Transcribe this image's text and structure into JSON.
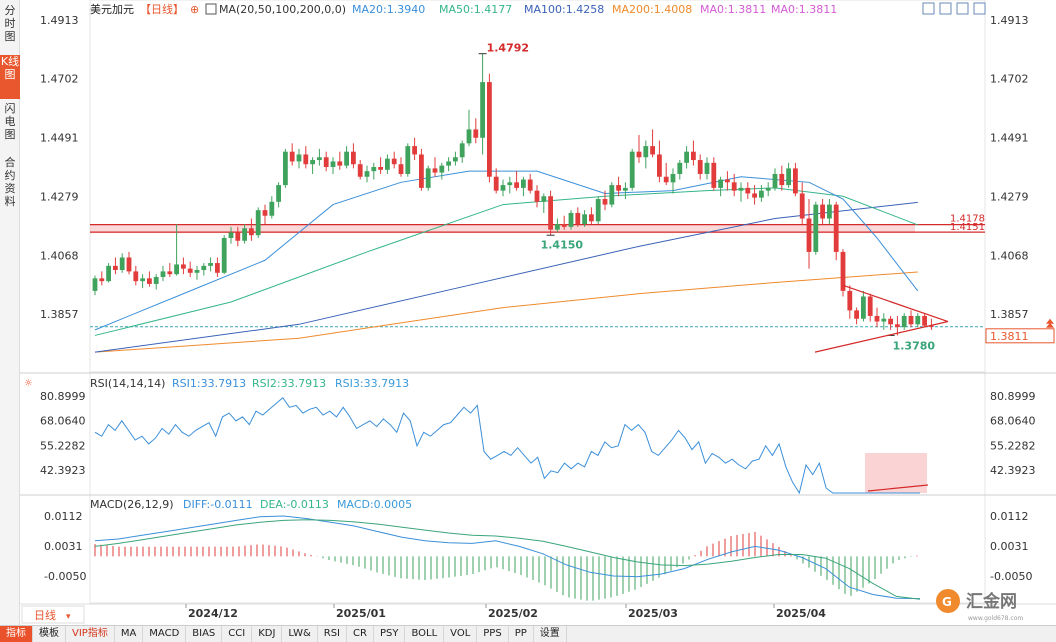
{
  "tabs": [
    "分时图",
    "K线图",
    "闪电图",
    "合约资料"
  ],
  "active_tab": 1,
  "header": {
    "symbol": "美元加元",
    "period": "【日线】",
    "ma_label": "MA(20,50,100,200,0,0)",
    "ma20": "MA20:1.3940",
    "ma50": "MA50:1.4177",
    "ma100": "MA100:1.4258",
    "ma200": "MA200:1.4008",
    "ma0a": "MA0:1.3811",
    "ma0b": "MA0:1.3811"
  },
  "rsi_header": {
    "label": "RSI(14,14,14)",
    "rsi1": "RSI1:33.7913",
    "rsi2": "RSI2:33.7913",
    "rsi3": "RSI3:33.7913"
  },
  "macd_header": {
    "label": "MACD(26,12,9)",
    "diff": "DIFF:-0.0111",
    "dea": "DEA:-0.0113",
    "macd": "MACD:0.0005"
  },
  "price_ticks": [
    "1.4913",
    "1.4702",
    "1.4491",
    "1.4279",
    "1.4068",
    "1.3857"
  ],
  "rsi_ticks": [
    "80.8999",
    "68.0640",
    "55.2282",
    "42.3923"
  ],
  "macd_ticks": [
    "0.0112",
    "0.0031",
    "-0.0050"
  ],
  "date_labels": [
    "2024/12",
    "2025/01",
    "2025/02",
    "2025/03",
    "2025/04"
  ],
  "current_price": "1.3811",
  "annotations": {
    "high": "1.4792",
    "mid_low": "1.4150",
    "low": "1.3780",
    "res1": "1.4178",
    "res2": "1.4151"
  },
  "period_tab": "日线",
  "toolbar": [
    "指标",
    "模板",
    "VIP指标",
    "MA",
    "MACD",
    "BIAS",
    "CCI",
    "KDJ",
    "LW&",
    "RSI",
    "CR",
    "PSY",
    "BOLL",
    "VOL",
    "PPS",
    "PP",
    "设置"
  ],
  "watermark": "汇金网",
  "watermark_url": "www.gold678.com",
  "colors": {
    "up": "#3fa35e",
    "down": "#e23b3b",
    "ma20": "#3b8fd9",
    "ma50": "#35b58a",
    "ma100": "#3a62b8",
    "ma200": "#f08a2c",
    "rsi": "#3b8fd9",
    "dea": "#3aa57a",
    "diff": "#3b8fd9"
  },
  "chart_data": {
    "type": "candlestick",
    "ylim": [
      1.378,
      1.4913
    ],
    "candles": [
      [
        1.394,
        1.3995,
        1.3925,
        1.3985
      ],
      [
        1.3985,
        1.401,
        1.396,
        1.3975
      ],
      [
        1.3975,
        1.404,
        1.397,
        1.403
      ],
      [
        1.403,
        1.406,
        1.4,
        1.4015
      ],
      [
        1.4015,
        1.4075,
        1.4005,
        1.406
      ],
      [
        1.406,
        1.408,
        1.4,
        1.401
      ],
      [
        1.401,
        1.403,
        1.396,
        1.3975
      ],
      [
        1.3975,
        1.4,
        1.395,
        1.3985
      ],
      [
        1.3985,
        1.401,
        1.3955,
        1.3965
      ],
      [
        1.3965,
        1.4,
        1.3945,
        1.399
      ],
      [
        1.399,
        1.403,
        1.3975,
        1.401
      ],
      [
        1.401,
        1.404,
        1.399,
        1.4
      ],
      [
        1.4,
        1.418,
        1.3995,
        1.4035
      ],
      [
        1.4035,
        1.406,
        1.4,
        1.402
      ],
      [
        1.402,
        1.4045,
        1.399,
        1.4005
      ],
      [
        1.4005,
        1.403,
        1.398,
        1.4015
      ],
      [
        1.4015,
        1.404,
        1.3995,
        1.403
      ],
      [
        1.403,
        1.406,
        1.401,
        1.404
      ],
      [
        1.404,
        1.406,
        1.399,
        1.4005
      ],
      [
        1.4005,
        1.414,
        1.4,
        1.413
      ],
      [
        1.413,
        1.417,
        1.411,
        1.415
      ],
      [
        1.415,
        1.417,
        1.41,
        1.412
      ],
      [
        1.412,
        1.418,
        1.411,
        1.4165
      ],
      [
        1.4165,
        1.42,
        1.412,
        1.414
      ],
      [
        1.414,
        1.424,
        1.413,
        1.423
      ],
      [
        1.423,
        1.425,
        1.418,
        1.421
      ],
      [
        1.421,
        1.428,
        1.42,
        1.426
      ],
      [
        1.426,
        1.433,
        1.424,
        1.432
      ],
      [
        1.432,
        1.445,
        1.431,
        1.444
      ],
      [
        1.444,
        1.447,
        1.439,
        1.4405
      ],
      [
        1.4405,
        1.445,
        1.438,
        1.443
      ],
      [
        1.443,
        1.446,
        1.438,
        1.4395
      ],
      [
        1.4395,
        1.442,
        1.436,
        1.441
      ],
      [
        1.441,
        1.445,
        1.439,
        1.442
      ],
      [
        1.442,
        1.444,
        1.437,
        1.4385
      ],
      [
        1.4385,
        1.442,
        1.436,
        1.4405
      ],
      [
        1.4405,
        1.444,
        1.4375,
        1.439
      ],
      [
        1.439,
        1.446,
        1.438,
        1.444
      ],
      [
        1.444,
        1.447,
        1.438,
        1.4395
      ],
      [
        1.4395,
        1.441,
        1.434,
        1.435
      ],
      [
        1.435,
        1.439,
        1.433,
        1.437
      ],
      [
        1.437,
        1.44,
        1.434,
        1.4385
      ],
      [
        1.4385,
        1.442,
        1.436,
        1.4375
      ],
      [
        1.4375,
        1.443,
        1.436,
        1.4415
      ],
      [
        1.4415,
        1.444,
        1.438,
        1.4395
      ],
      [
        1.4395,
        1.442,
        1.435,
        1.436
      ],
      [
        1.436,
        1.447,
        1.435,
        1.446
      ],
      [
        1.446,
        1.449,
        1.441,
        1.443
      ],
      [
        1.443,
        1.445,
        1.43,
        1.431
      ],
      [
        1.431,
        1.439,
        1.43,
        1.438
      ],
      [
        1.438,
        1.442,
        1.435,
        1.4365
      ],
      [
        1.4365,
        1.44,
        1.434,
        1.439
      ],
      [
        1.439,
        1.442,
        1.437,
        1.4405
      ],
      [
        1.4405,
        1.444,
        1.439,
        1.442
      ],
      [
        1.442,
        1.448,
        1.44,
        1.447
      ],
      [
        1.447,
        1.459,
        1.446,
        1.452
      ],
      [
        1.452,
        1.456,
        1.447,
        1.449
      ],
      [
        1.449,
        1.4792,
        1.443,
        1.469
      ],
      [
        1.469,
        1.472,
        1.433,
        1.435
      ],
      [
        1.435,
        1.438,
        1.429,
        1.43
      ],
      [
        1.43,
        1.434,
        1.428,
        1.432
      ],
      [
        1.432,
        1.435,
        1.429,
        1.433
      ],
      [
        1.433,
        1.437,
        1.43,
        1.431
      ],
      [
        1.431,
        1.435,
        1.428,
        1.434
      ],
      [
        1.434,
        1.436,
        1.429,
        1.43
      ],
      [
        1.43,
        1.432,
        1.424,
        1.426
      ],
      [
        1.426,
        1.429,
        1.422,
        1.428
      ],
      [
        1.428,
        1.43,
        1.414,
        1.416
      ],
      [
        1.416,
        1.42,
        1.415,
        1.418
      ],
      [
        1.418,
        1.421,
        1.416,
        1.417
      ],
      [
        1.417,
        1.423,
        1.416,
        1.422
      ],
      [
        1.422,
        1.424,
        1.417,
        1.418
      ],
      [
        1.418,
        1.423,
        1.417,
        1.4215
      ],
      [
        1.4215,
        1.424,
        1.418,
        1.419
      ],
      [
        1.419,
        1.428,
        1.418,
        1.427
      ],
      [
        1.427,
        1.43,
        1.423,
        1.425
      ],
      [
        1.425,
        1.433,
        1.424,
        1.432
      ],
      [
        1.432,
        1.435,
        1.428,
        1.43
      ],
      [
        1.43,
        1.433,
        1.427,
        1.431
      ],
      [
        1.431,
        1.445,
        1.43,
        1.444
      ],
      [
        1.444,
        1.45,
        1.44,
        1.442
      ],
      [
        1.442,
        1.448,
        1.438,
        1.446
      ],
      [
        1.446,
        1.452,
        1.442,
        1.443
      ],
      [
        1.443,
        1.448,
        1.433,
        1.435
      ],
      [
        1.435,
        1.44,
        1.432,
        1.433
      ],
      [
        1.433,
        1.438,
        1.429,
        1.436
      ],
      [
        1.436,
        1.441,
        1.434,
        1.44
      ],
      [
        1.44,
        1.446,
        1.438,
        1.444
      ],
      [
        1.444,
        1.448,
        1.439,
        1.441
      ],
      [
        1.441,
        1.443,
        1.434,
        1.436
      ],
      [
        1.436,
        1.442,
        1.434,
        1.44
      ],
      [
        1.44,
        1.442,
        1.43,
        1.431
      ],
      [
        1.431,
        1.435,
        1.428,
        1.434
      ],
      [
        1.434,
        1.437,
        1.43,
        1.433
      ],
      [
        1.433,
        1.436,
        1.428,
        1.43
      ],
      [
        1.43,
        1.433,
        1.426,
        1.431
      ],
      [
        1.431,
        1.433,
        1.427,
        1.429
      ],
      [
        1.429,
        1.432,
        1.425,
        1.4275
      ],
      [
        1.4275,
        1.432,
        1.426,
        1.43
      ],
      [
        1.43,
        1.433,
        1.428,
        1.431
      ],
      [
        1.431,
        1.438,
        1.43,
        1.436
      ],
      [
        1.436,
        1.439,
        1.43,
        1.432
      ],
      [
        1.432,
        1.44,
        1.431,
        1.438
      ],
      [
        1.438,
        1.44,
        1.428,
        1.429
      ],
      [
        1.429,
        1.433,
        1.418,
        1.42
      ],
      [
        1.42,
        1.427,
        1.402,
        1.408
      ],
      [
        1.408,
        1.426,
        1.407,
        1.425
      ],
      [
        1.425,
        1.427,
        1.418,
        1.42
      ],
      [
        1.42,
        1.427,
        1.418,
        1.425
      ],
      [
        1.425,
        1.426,
        1.405,
        1.408
      ],
      [
        1.408,
        1.409,
        1.392,
        1.394
      ],
      [
        1.394,
        1.396,
        1.384,
        1.387
      ],
      [
        1.387,
        1.388,
        1.382,
        1.384
      ],
      [
        1.384,
        1.394,
        1.383,
        1.392
      ],
      [
        1.392,
        1.393,
        1.383,
        1.385
      ],
      [
        1.385,
        1.388,
        1.381,
        1.383
      ],
      [
        1.383,
        1.386,
        1.38,
        1.384
      ],
      [
        1.384,
        1.385,
        1.38,
        1.382
      ],
      [
        1.382,
        1.385,
        1.378,
        1.381
      ],
      [
        1.381,
        1.386,
        1.38,
        1.385
      ],
      [
        1.385,
        1.387,
        1.381,
        1.382
      ],
      [
        1.382,
        1.386,
        1.381,
        1.385
      ],
      [
        1.385,
        1.386,
        1.381,
        1.3815
      ],
      [
        1.3815,
        1.384,
        1.38,
        1.3811
      ]
    ],
    "ma20": [
      [
        0,
        1.38
      ],
      [
        15,
        1.395
      ],
      [
        25,
        1.405
      ],
      [
        35,
        1.425
      ],
      [
        45,
        1.433
      ],
      [
        55,
        1.437
      ],
      [
        65,
        1.437
      ],
      [
        75,
        1.429
      ],
      [
        85,
        1.43
      ],
      [
        95,
        1.435
      ],
      [
        105,
        1.433
      ],
      [
        110,
        1.427
      ],
      [
        115,
        1.413
      ],
      [
        121,
        1.394
      ]
    ],
    "ma50": [
      [
        0,
        1.378
      ],
      [
        20,
        1.39
      ],
      [
        40,
        1.408
      ],
      [
        60,
        1.425
      ],
      [
        75,
        1.428
      ],
      [
        90,
        1.43
      ],
      [
        100,
        1.431
      ],
      [
        110,
        1.428
      ],
      [
        121,
        1.4177
      ]
    ],
    "ma100": [
      [
        0,
        1.372
      ],
      [
        30,
        1.382
      ],
      [
        55,
        1.396
      ],
      [
        80,
        1.41
      ],
      [
        100,
        1.42
      ],
      [
        121,
        1.4258
      ]
    ],
    "ma200": [
      [
        0,
        1.372
      ],
      [
        30,
        1.377
      ],
      [
        60,
        1.388
      ],
      [
        80,
        1.393
      ],
      [
        100,
        1.397
      ],
      [
        121,
        1.4008
      ]
    ],
    "rsi": [
      62,
      60,
      66,
      63,
      68,
      63,
      58,
      60,
      56,
      59,
      64,
      61,
      66,
      62,
      60,
      63,
      65,
      67,
      60,
      70,
      72,
      68,
      70,
      66,
      73,
      71,
      74,
      77,
      80,
      75,
      76,
      72,
      74,
      75,
      71,
      73,
      70,
      75,
      70,
      64,
      66,
      68,
      65,
      69,
      66,
      62,
      72,
      68,
      55,
      62,
      60,
      63,
      66,
      67,
      71,
      75,
      72,
      76,
      52,
      48,
      50,
      52,
      50,
      54,
      50,
      46,
      49,
      38,
      42,
      41,
      46,
      43,
      46,
      44,
      52,
      50,
      57,
      54,
      55,
      66,
      63,
      66,
      62,
      52,
      50,
      54,
      58,
      63,
      59,
      53,
      57,
      46,
      51,
      49,
      46,
      48,
      45,
      43,
      47,
      48,
      55,
      50,
      56,
      44,
      36,
      28,
      45,
      40,
      46,
      33,
      25,
      20,
      19,
      28,
      22,
      20,
      22,
      21,
      19,
      24,
      22,
      24,
      22,
      21
    ],
    "rsi_ylim": [
      20,
      85
    ],
    "macd_diff": [
      0.0045,
      0.005,
      0.006,
      0.007,
      0.008,
      0.009,
      0.01,
      0.011,
      0.0112,
      0.0105,
      0.0095,
      0.0085,
      0.007,
      0.0055,
      0.0045,
      0.004,
      0.0038,
      0.0045,
      0.003,
      0.001,
      -0.002,
      -0.004,
      -0.005,
      -0.0052,
      -0.0045,
      -0.003,
      -0.0005,
      0.0015,
      0.003,
      0.002,
      0.0,
      -0.003,
      -0.008,
      -0.01,
      -0.011,
      -0.0111
    ],
    "macd_dea": [
      0.003,
      0.0038,
      0.0048,
      0.0058,
      0.0068,
      0.0078,
      0.0088,
      0.0095,
      0.01,
      0.0102,
      0.01,
      0.0096,
      0.009,
      0.0082,
      0.0074,
      0.0066,
      0.006,
      0.0058,
      0.0052,
      0.0044,
      0.003,
      0.0015,
      0.0,
      -0.0012,
      -0.002,
      -0.0022,
      -0.0018,
      -0.001,
      0.0,
      0.0008,
      0.0008,
      -0.0002,
      -0.003,
      -0.007,
      -0.0105,
      -0.0113
    ],
    "macd_ylim": [
      -0.012,
      0.014
    ]
  }
}
